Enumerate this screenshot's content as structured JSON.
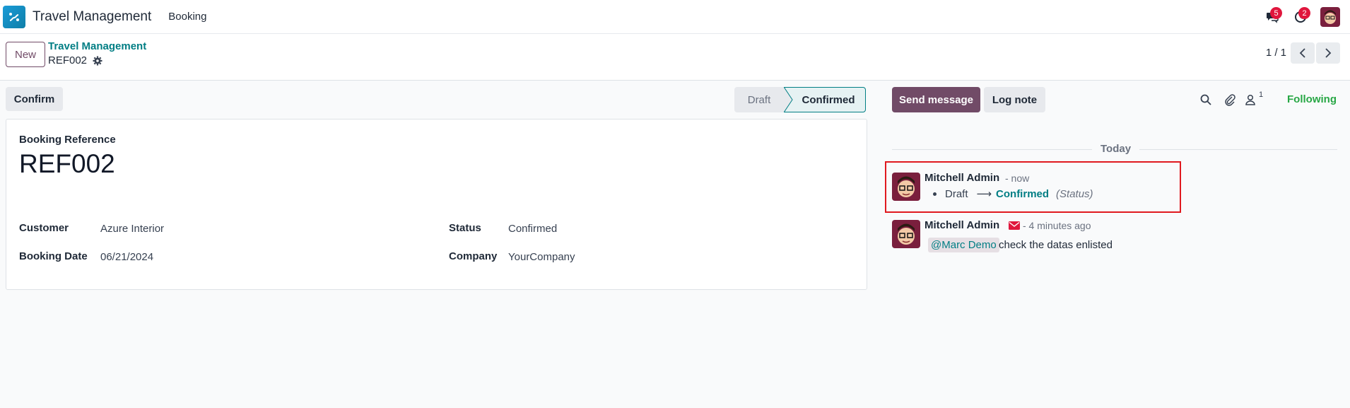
{
  "navbar": {
    "app_name": "Travel Management",
    "menu_booking": "Booking",
    "messages_badge": "5",
    "activities_badge": "2"
  },
  "control_panel": {
    "new_label": "New",
    "breadcrumb_parent": "Travel Management",
    "breadcrumb_current": "REF002",
    "pager_value": "1 / 1"
  },
  "form": {
    "confirm_label": "Confirm",
    "status_steps": [
      "Draft",
      "Confirmed"
    ],
    "active_status": "Confirmed",
    "booking_reference_label": "Booking Reference",
    "booking_reference": "REF002",
    "fields": {
      "customer_label": "Customer",
      "customer_value": "Azure Interior",
      "booking_date_label": "Booking Date",
      "booking_date_value": "06/21/2024",
      "status_label": "Status",
      "status_value": "Confirmed",
      "company_label": "Company",
      "company_value": "YourCompany"
    }
  },
  "chatter": {
    "send_message_label": "Send message",
    "log_note_label": "Log note",
    "follower_count": "1",
    "following_label": "Following",
    "date_separator": "Today",
    "messages": [
      {
        "author": "Mitchell Admin",
        "time": "- now",
        "tracking_old": "Draft",
        "tracking_arrow": "⟶",
        "tracking_new": "Confirmed",
        "tracking_field": "(Status)"
      },
      {
        "author": "Mitchell Admin",
        "time": "- 4 minutes ago",
        "mention": "@Marc Demo",
        "body": "check the datas enlisted"
      }
    ]
  },
  "colors": {
    "primary": "#714b67",
    "accent_teal": "#017e84",
    "following_green": "#28a745",
    "badge_red": "#e0163d",
    "highlight_red": "#e0191f"
  }
}
